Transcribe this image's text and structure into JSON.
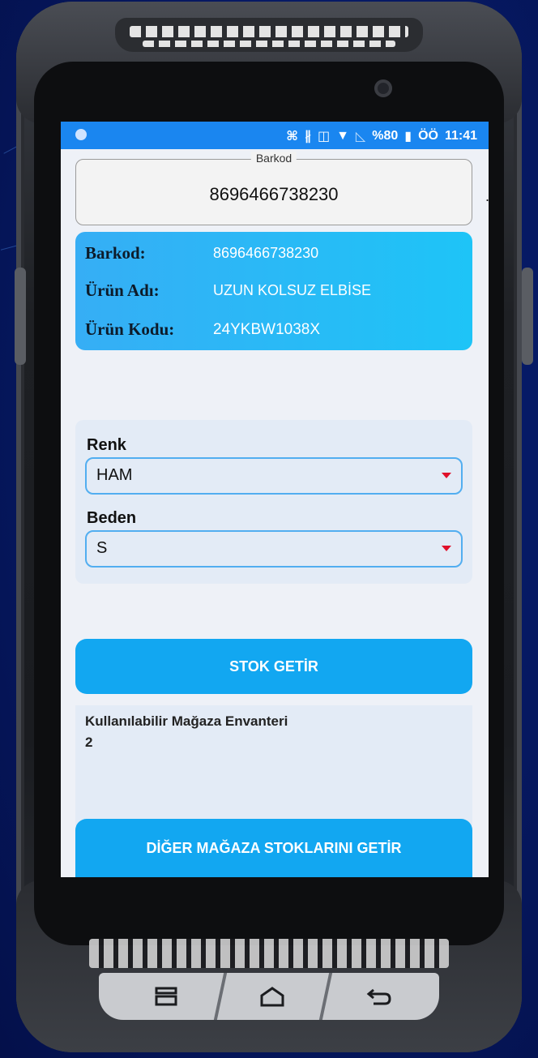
{
  "status_bar": {
    "battery_percent": "%80",
    "time": "11:41",
    "extra": "ÖÖ"
  },
  "barcode_field": {
    "legend": "Barkod",
    "value": "8696466738230",
    "side_mark": "."
  },
  "product": {
    "barcode_label": "Barkod:",
    "barcode_value": "8696466738230",
    "name_label": "Ürün Adı:",
    "name_value": "UZUN KOLSUZ ELBİSE",
    "code_label": "Ürün Kodu:",
    "code_value": "24YKBW1038X"
  },
  "filters": {
    "color_label": "Renk",
    "color_value": "HAM",
    "size_label": "Beden",
    "size_value": "S"
  },
  "actions": {
    "stock_button": "STOK GETİR",
    "other_stores_button": "DİĞER MAĞAZA STOKLARINI GETİR"
  },
  "inventory": {
    "label": "Kullanılabilir Mağaza Envanteri",
    "value": "2"
  },
  "colors": {
    "status_bar": "#1a86f0",
    "info_card": "#1ec4f7",
    "button": "#12a7f1",
    "caret": "#e0102a"
  },
  "icons": [
    "scan-icon",
    "bluetooth-icon",
    "vibrate-icon",
    "wifi-icon",
    "no-signal-icon",
    "battery-icon",
    "recent-apps-icon",
    "home-icon",
    "back-icon"
  ]
}
